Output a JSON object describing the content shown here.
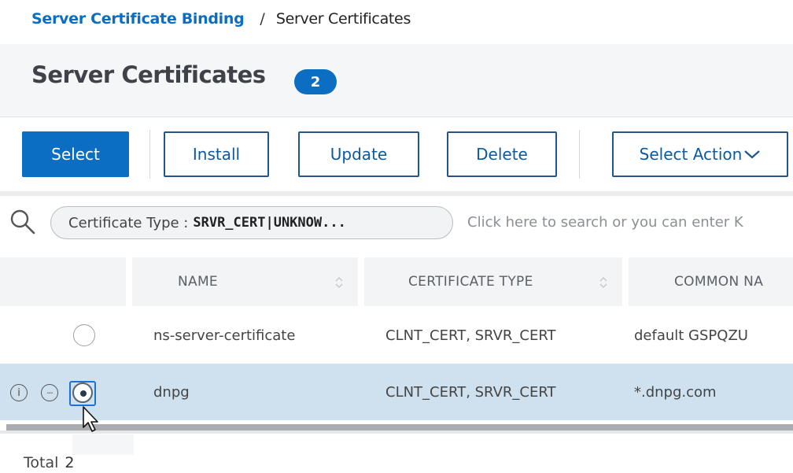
{
  "breadcrumb": {
    "parent": "Server Certificate Binding",
    "separator": "/",
    "current": "Server Certificates"
  },
  "header": {
    "title": "Server Certificates",
    "count": "2"
  },
  "toolbar": {
    "select_label": "Select",
    "install_label": "Install",
    "update_label": "Update",
    "delete_label": "Delete",
    "select_action_label": "Select Action"
  },
  "search": {
    "filter_key": "Certificate Type :",
    "filter_value": "SRVR_CERT|UNKNOW...",
    "placeholder": "Click here to search or you can enter K"
  },
  "table": {
    "columns": [
      "NAME",
      "CERTIFICATE TYPE",
      "COMMON NA"
    ],
    "rows": [
      {
        "name": "ns-server-certificate",
        "certificate_type": "CLNT_CERT, SRVR_CERT",
        "common_name": "default GSPQZU",
        "selected": false
      },
      {
        "name": "dnpg",
        "certificate_type": "CLNT_CERT, SRVR_CERT",
        "common_name": "*.dnpg.com",
        "selected": true
      }
    ]
  },
  "footer": {
    "total_label": "Total",
    "total_value": "2"
  },
  "colors": {
    "accent": "#0b6ec2",
    "selected_row": "#cfe1ee",
    "header_bg": "#f4f6f8"
  },
  "icons": [
    "search-icon",
    "sort-icon",
    "info-icon",
    "more-icon",
    "cursor-icon",
    "chevron-down-icon"
  ]
}
